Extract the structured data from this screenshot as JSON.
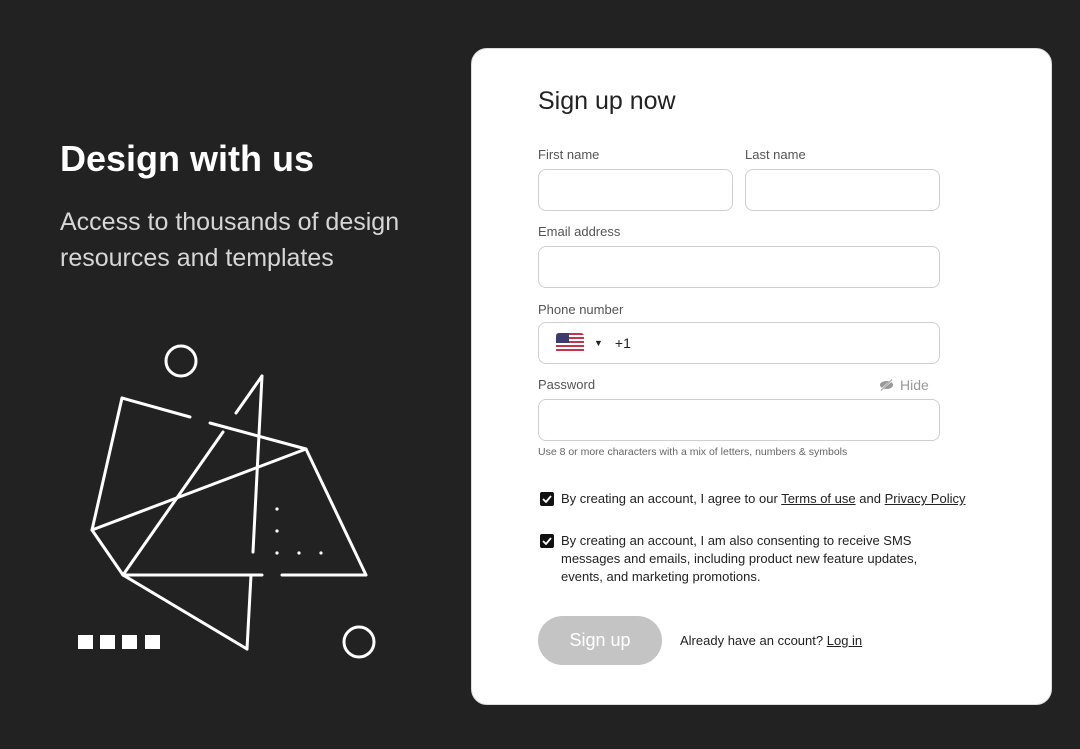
{
  "hero": {
    "title": "Design with us",
    "subtitle": "Access to thousands of design resources and templates"
  },
  "form": {
    "title": "Sign up now",
    "first_name": {
      "label": "First name",
      "value": ""
    },
    "last_name": {
      "label": "Last name",
      "value": ""
    },
    "email": {
      "label": "Email address",
      "value": ""
    },
    "phone": {
      "label": "Phone number",
      "country_icon": "us-flag-icon",
      "dial_code": "+1",
      "value": ""
    },
    "password": {
      "label": "Password",
      "toggle_label": "Hide",
      "toggle_icon": "eye-off-icon",
      "value": "",
      "hint": "Use 8 or more characters with a mix of letters, numbers & symbols"
    },
    "terms": {
      "checked": true,
      "text_before": "By creating an account, I agree to our",
      "terms_link": "Terms of use",
      "and": "and",
      "privacy_link": "Privacy Policy"
    },
    "sms": {
      "checked": true,
      "text": "By creating an account, I am also consenting to receive SMS messages and emails, including product new feature updates, events, and marketing promotions."
    },
    "submit_label": "Sign up",
    "login_prompt": "Already have an ccount?",
    "login_link": "Log in"
  },
  "colors": {
    "background": "#222222",
    "card": "#ffffff",
    "button_disabled": "#c4c4c4"
  }
}
